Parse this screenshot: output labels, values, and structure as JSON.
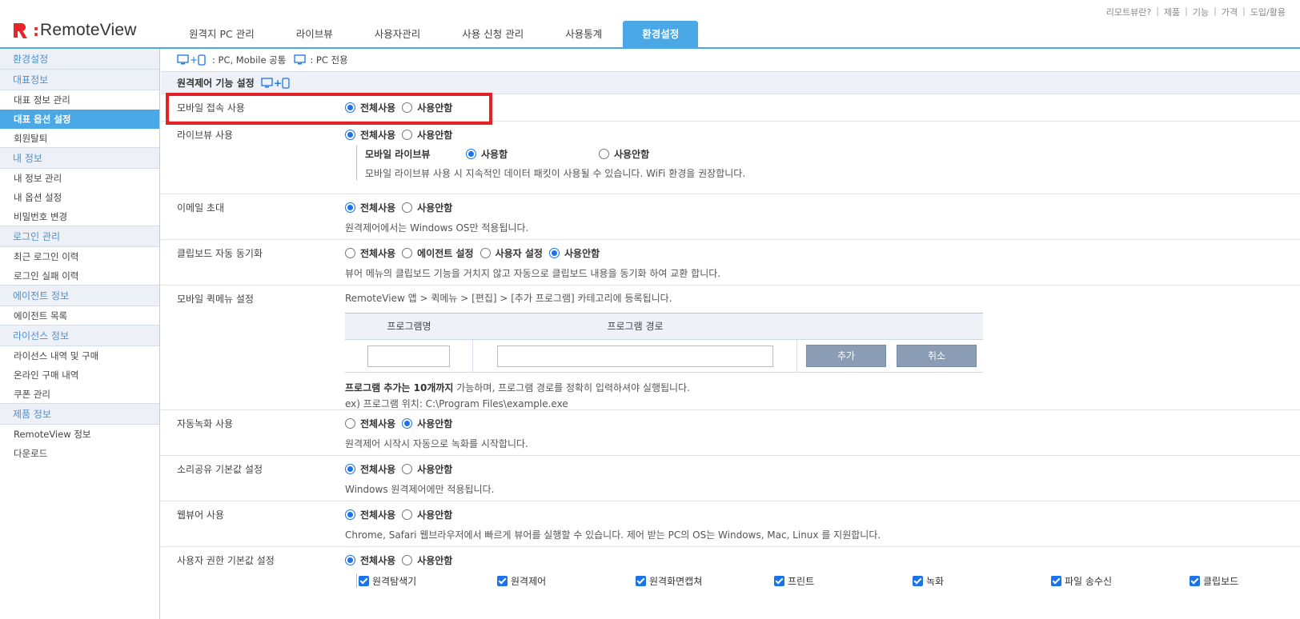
{
  "header": {
    "logo_text": "RemoteView",
    "util_links": [
      "리모트뷰란?",
      "제품",
      "기능",
      "가격",
      "도입/활용"
    ],
    "tabs": [
      {
        "label": "원격지 PC 관리",
        "active": false
      },
      {
        "label": "라이브뷰",
        "active": false
      },
      {
        "label": "사용자관리",
        "active": false
      },
      {
        "label": "사용 신청 관리",
        "active": false
      },
      {
        "label": "사용통계",
        "active": false
      },
      {
        "label": "환경설정",
        "active": true
      }
    ],
    "accent_color": "#4aa8e6",
    "brand_color": "#e8242b"
  },
  "sidebar": {
    "top": "환경설정",
    "groups": [
      {
        "title": "대표정보",
        "items": [
          "대표 정보 관리",
          "대표 옵션 설정",
          "회원탈퇴"
        ],
        "active": 1
      },
      {
        "title": "내 정보",
        "items": [
          "내 정보 관리",
          "내 옵션 설정",
          "비밀번호 변경"
        ]
      },
      {
        "title": "로그인 관리",
        "items": [
          "최근 로그인 이력",
          "로그인 실패 이력"
        ]
      },
      {
        "title": "에이전트 정보",
        "items": [
          "에이전트 목록"
        ]
      },
      {
        "title": "라이선스 정보",
        "items": [
          "라이선스 내역 및 구매",
          "온라인 구매 내역",
          "쿠폰 관리"
        ]
      },
      {
        "title": "제품 정보",
        "items": [
          "RemoteView 정보",
          "다운로드"
        ]
      }
    ]
  },
  "legend": {
    "common": ": PC, Mobile 공통",
    "pc_only": ": PC 전용"
  },
  "section_title": "원격제어 기능 설정",
  "rows": {
    "mobile_access": {
      "label": "모바일 접속 사용",
      "opt1": "전체사용",
      "opt2": "사용안함"
    },
    "liveview": {
      "label": "라이브뷰 사용",
      "opt1": "전체사용",
      "opt2": "사용안함",
      "sub_title": "모바일 라이브뷰",
      "sub_opt1": "사용함",
      "sub_opt2": "사용안함",
      "sub_desc": "모바일 라이브뷰 사용 시 지속적인 데이터 패킷이 사용될 수 있습니다. WiFi 환경을 권장합니다."
    },
    "email_invite": {
      "label": "이메일 초대",
      "opt1": "전체사용",
      "opt2": "사용안함",
      "desc": "원격제어에서는 Windows OS만 적용됩니다."
    },
    "clipboard": {
      "label": "클립보드 자동 동기화",
      "opt1": "전체사용",
      "opt2": "에이전트 설정",
      "opt3": "사용자 설정",
      "opt4": "사용안함",
      "desc": "뷰어 메뉴의 클립보드 기능을 거치지 않고 자동으로 클립보드 내용을 동기화 하여 교환 합니다."
    },
    "quickmenu": {
      "label": "모바일 퀵메뉴 설정",
      "intro": "RemoteView 앱 > 퀵메뉴 > [편집] > [추가 프로그램] 카테고리에 등록됩니다.",
      "col_name": "프로그램명",
      "col_path": "프로그램 경로",
      "add_btn": "추가",
      "cancel_btn": "취소",
      "note_bold": "프로그램 추가는 10개까지",
      "note_rest": " 가능하며, 프로그램 경로를 정확히 입력하셔야 실행됩니다.",
      "example": "ex) 프로그램 위치: C:\\Program Files\\example.exe"
    },
    "auto_record": {
      "label": "자동녹화 사용",
      "opt1": "전체사용",
      "opt2": "사용안함",
      "desc": "원격제어 시작시 자동으로 녹화를 시작합니다."
    },
    "sound_share": {
      "label": "소리공유 기본값 설정",
      "opt1": "전체사용",
      "opt2": "사용안함",
      "desc": "Windows 원격제어에만 적용됩니다."
    },
    "web_viewer": {
      "label": "웹뷰어 사용",
      "opt1": "전체사용",
      "opt2": "사용안함",
      "desc": "Chrome, Safari 웹브라우저에서 빠르게 뷰어를 실행할 수 있습니다. 제어 받는 PC의 OS는 Windows, Mac, Linux 를 지원합니다."
    },
    "user_perm": {
      "label": "사용자 권한 기본값 설정",
      "opt1": "전체사용",
      "opt2": "사용안함",
      "checks": [
        "원격탐색기",
        "원격제어",
        "원격화면캡쳐",
        "프린트",
        "녹화",
        "파일 송수신",
        "클립보드"
      ]
    }
  }
}
